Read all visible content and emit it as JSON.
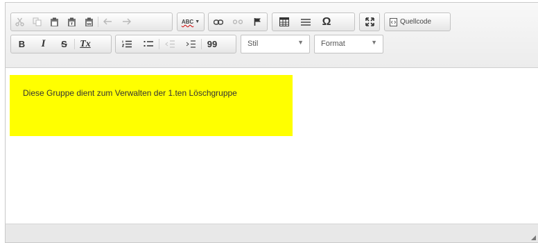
{
  "toolbar": {
    "source_button_label": "Quellcode",
    "bold_label": "B",
    "italic_label": "I",
    "strike_label": "S",
    "removeformat_label": "Tx",
    "blockquote_label": "99",
    "spellcheck_label": "ABC",
    "omega_label": "Ω",
    "style_combo": {
      "value": "Stil"
    },
    "format_combo": {
      "value": "Format"
    }
  },
  "content": {
    "paragraph": "Diese Gruppe dient zum Verwalten der 1.ten Löschgruppe",
    "highlight_color": "#ffff00"
  },
  "icons": [
    "cut-icon",
    "copy-icon",
    "paste-icon",
    "paste-text-icon",
    "paste-word-icon",
    "undo-icon",
    "redo-icon",
    "spellcheck-icon",
    "link-icon",
    "unlink-icon",
    "anchor-icon",
    "table-icon",
    "horizontal-rule-icon",
    "special-char-icon",
    "maximize-icon",
    "source-icon",
    "numbered-list-icon",
    "bulleted-list-icon",
    "outdent-icon",
    "indent-icon",
    "resize-grip-icon"
  ]
}
